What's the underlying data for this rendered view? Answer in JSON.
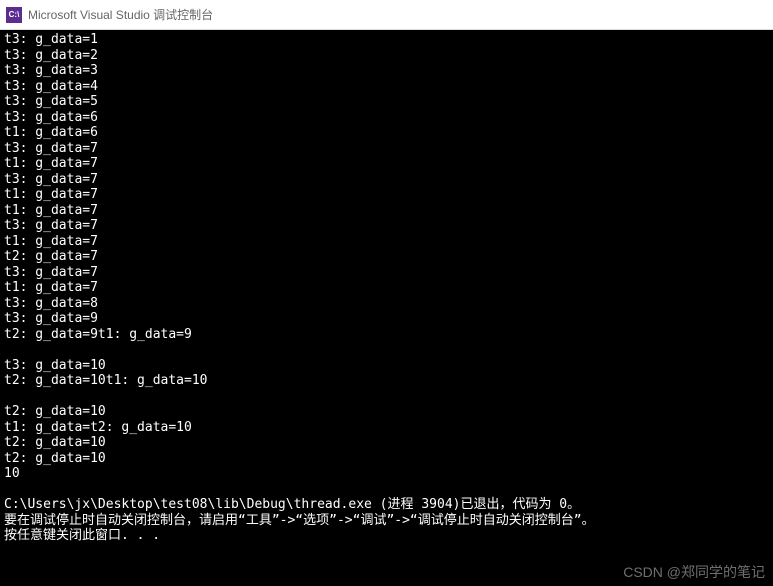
{
  "window": {
    "icon_text": "C:\\",
    "title": "Microsoft Visual Studio 调试控制台"
  },
  "console": {
    "lines": [
      "t3: g_data=1",
      "t3: g_data=2",
      "t3: g_data=3",
      "t3: g_data=4",
      "t3: g_data=5",
      "t3: g_data=6",
      "t1: g_data=6",
      "t3: g_data=7",
      "t1: g_data=7",
      "t3: g_data=7",
      "t1: g_data=7",
      "t1: g_data=7",
      "t3: g_data=7",
      "t1: g_data=7",
      "t2: g_data=7",
      "t3: g_data=7",
      "t1: g_data=7",
      "t3: g_data=8",
      "t3: g_data=9",
      "t2: g_data=9t1: g_data=9",
      "",
      "t3: g_data=10",
      "t2: g_data=10t1: g_data=10",
      "",
      "t2: g_data=10",
      "t1: g_data=t2: g_data=10",
      "t2: g_data=10",
      "t2: g_data=10",
      "10",
      "",
      "C:\\Users\\jx\\Desktop\\test08\\lib\\Debug\\thread.exe (进程 3904)已退出，代码为 0。",
      "要在调试停止时自动关闭控制台，请启用“工具”->“选项”->“调试”->“调试停止时自动关闭控制台”。",
      "按任意键关闭此窗口. . ."
    ]
  },
  "watermark": "CSDN @郑同学的笔记"
}
